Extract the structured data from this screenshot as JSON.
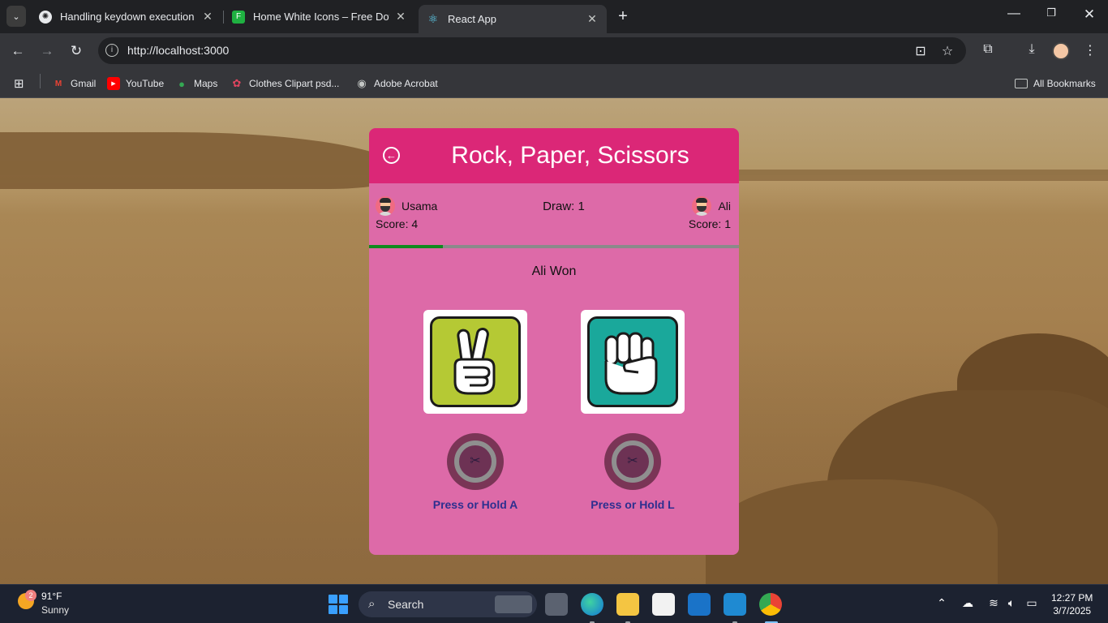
{
  "browser": {
    "tabs": [
      {
        "title": "Handling keydown execution ti",
        "favicon": "openai-icon",
        "active": false
      },
      {
        "title": "Home White Icons – Free Down",
        "favicon": "flaticon-icon",
        "active": false
      },
      {
        "title": "React App",
        "favicon": "react-icon",
        "active": true
      }
    ],
    "url": "http://localhost:3000",
    "bookmarks": [
      {
        "label": "Gmail",
        "icon": "gmail-icon"
      },
      {
        "label": "YouTube",
        "icon": "youtube-icon"
      },
      {
        "label": "Maps",
        "icon": "maps-icon"
      },
      {
        "label": "Clothes Clipart psd...",
        "icon": "clipart-icon"
      },
      {
        "label": "Adobe Acrobat",
        "icon": "acrobat-icon"
      }
    ],
    "all_bookmarks_label": "All Bookmarks"
  },
  "game": {
    "title": "Rock, Paper, Scissors",
    "player1": {
      "name": "Usama",
      "score_text": "Score: 4",
      "key_label": "Press or Hold A",
      "move": "scissors"
    },
    "player2": {
      "name": "Ali",
      "score_text": "Score: 1",
      "key_label": "Press or Hold L",
      "move": "rock"
    },
    "draw_text": "Draw: 1",
    "result": "Ali Won",
    "progress_fraction": 0.2,
    "colors": {
      "header": "#db2777",
      "card": "#dd6aa8",
      "progress": "#0f8a1f",
      "scissors_tile": "#b5c934",
      "rock_tile": "#1aa89b"
    }
  },
  "taskbar": {
    "weather_temp": "91°F",
    "weather_cond": "Sunny",
    "weather_badge": "2",
    "search_label": "Search",
    "time": "12:27 PM",
    "date": "3/7/2025"
  }
}
